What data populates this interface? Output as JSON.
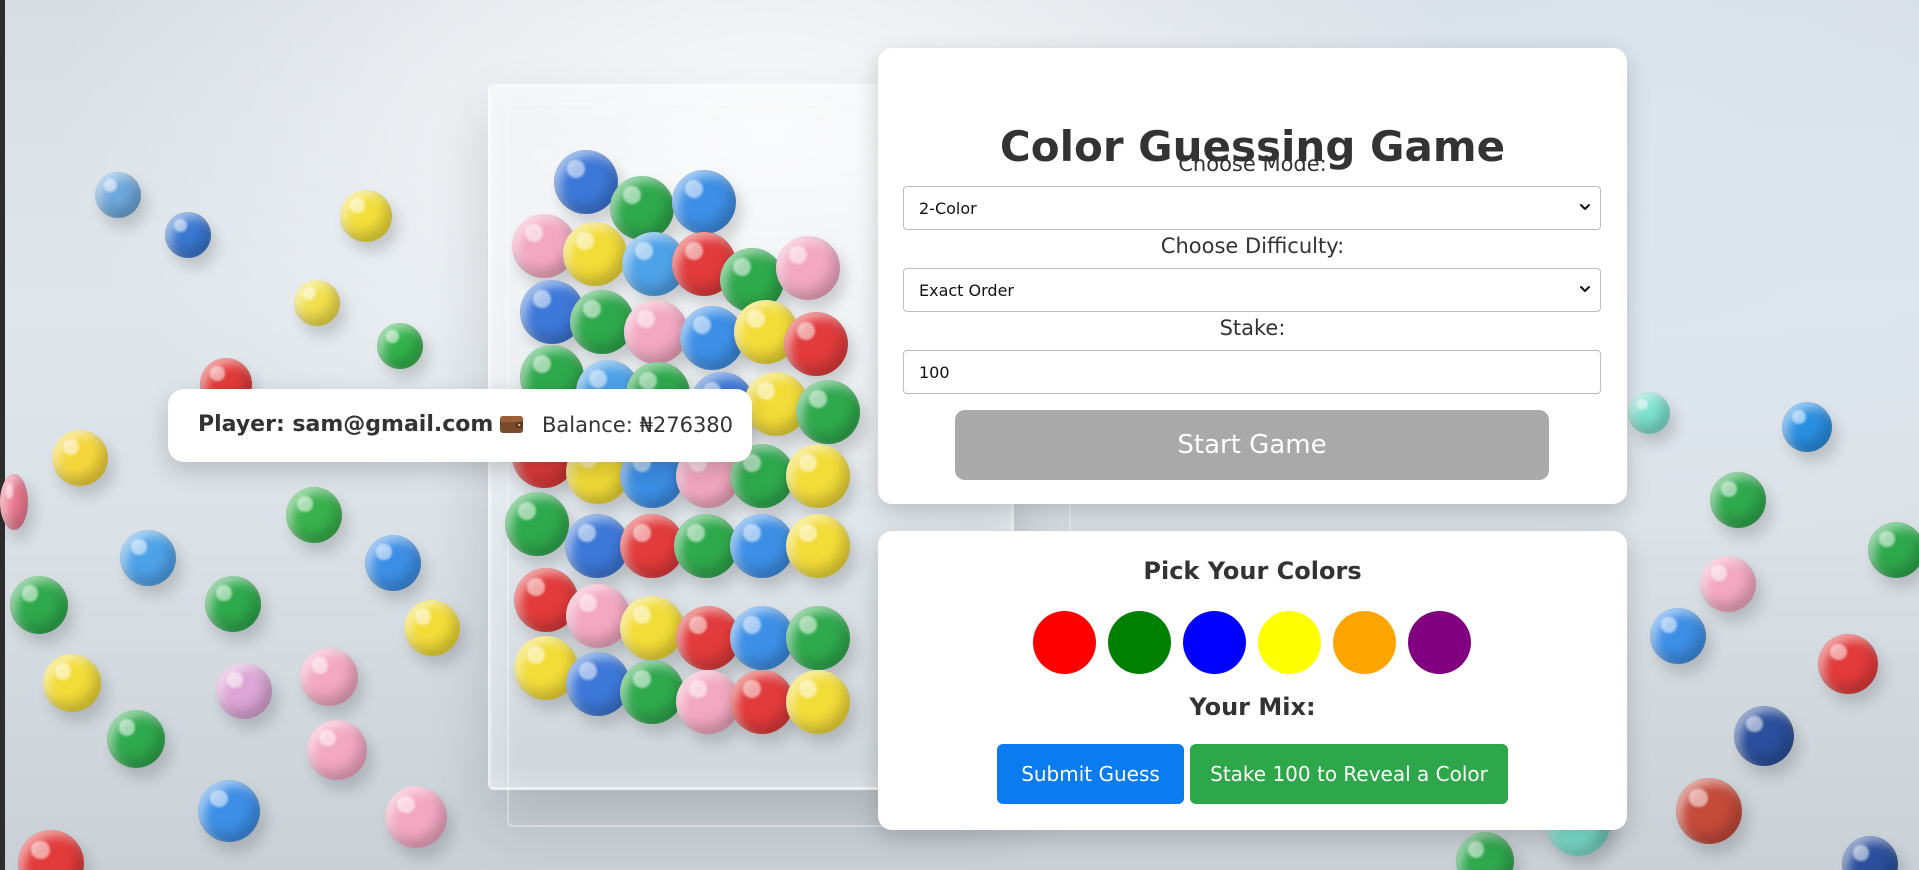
{
  "background": {
    "description_icons": [
      "candy-marbles-background"
    ]
  },
  "player": {
    "label": "Player: sam@gmail.com",
    "wallet_icon": "wallet-icon",
    "balance_label": "Balance: ₦276380"
  },
  "game": {
    "title": "Color Guessing Game",
    "mode_label": "Choose Mode:",
    "mode_value": "2-Color",
    "difficulty_label": "Choose Difficulty:",
    "difficulty_value": "Exact Order",
    "stake_label": "Stake:",
    "stake_value": "100",
    "start_button": "Start Game"
  },
  "pick": {
    "title": "Pick Your Colors",
    "colors": [
      "#ff0000",
      "#008000",
      "#0000ff",
      "#ffff00",
      "#ffa500",
      "#800080"
    ],
    "mix_title": "Your Mix:",
    "submit_button": "Submit Guess",
    "reveal_button": "Stake 100 to Reveal a Color"
  }
}
